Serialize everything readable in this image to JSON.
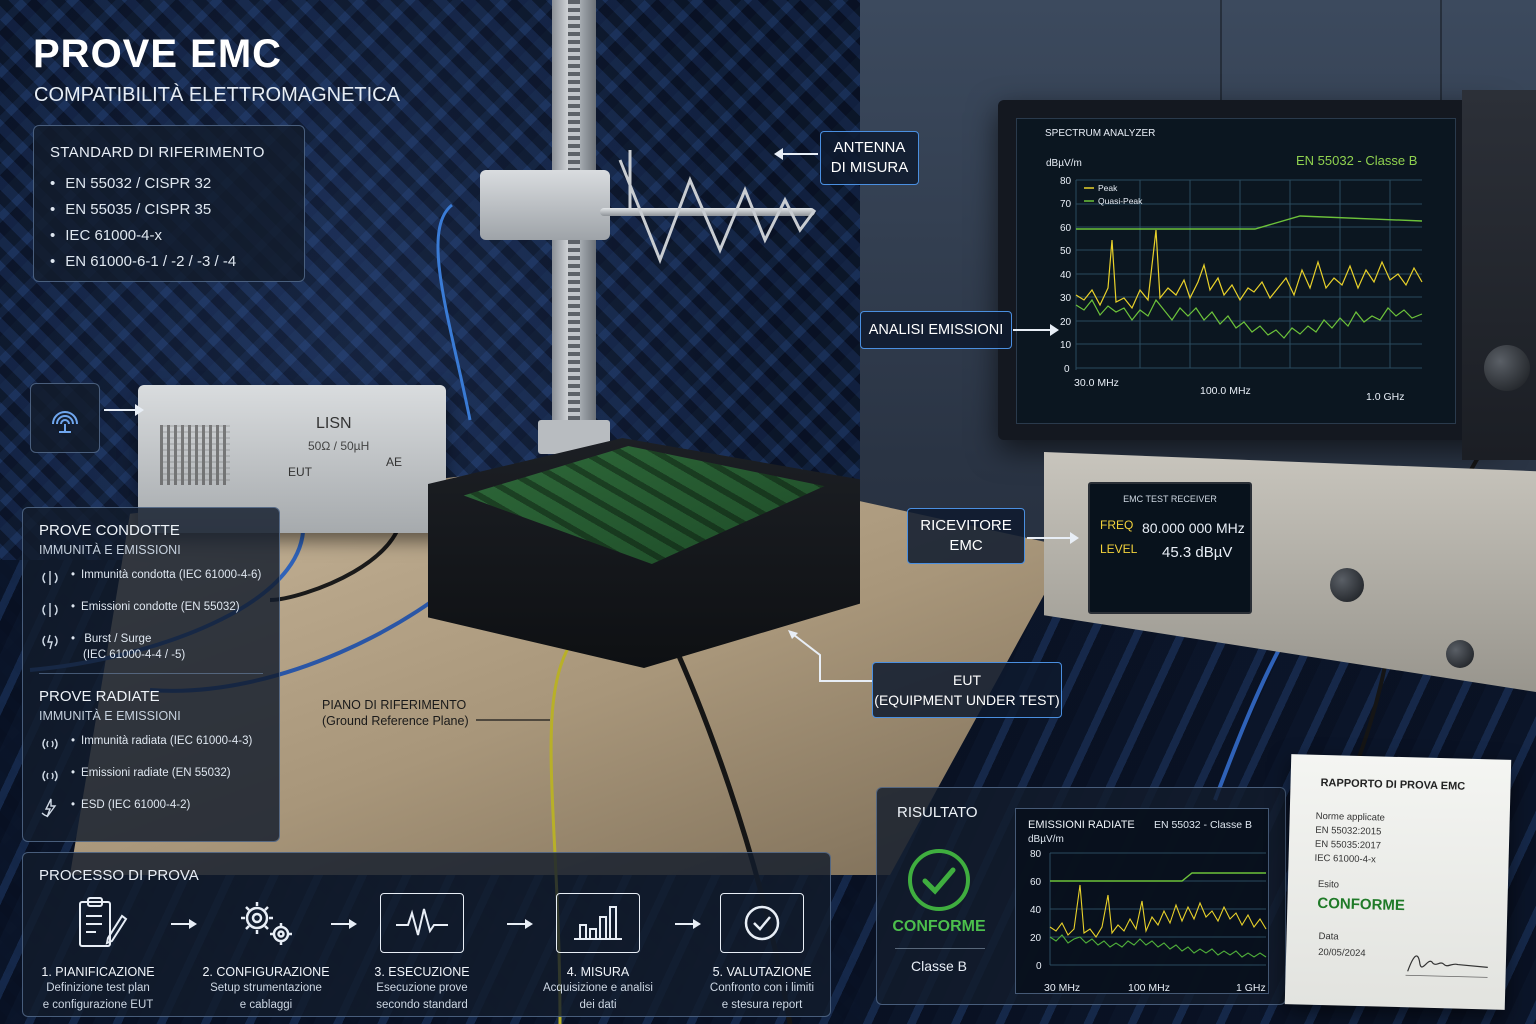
{
  "header": {
    "title": "PROVE EMC",
    "subtitle": "COMPATIBILITÀ ELETTROMAGNETICA"
  },
  "standards": {
    "title": "STANDARD DI RIFERIMENTO",
    "items": [
      "EN 55032 / CISPR 32",
      "EN 55035 / CISPR 35",
      "IEC 61000-4-x",
      "EN 61000-6-1 / -2 / -3 / -4"
    ]
  },
  "lisn": {
    "name": "LISN",
    "spec": "50Ω / 50µH",
    "port_eut": "EUT",
    "port_ae": "AE"
  },
  "conducted": {
    "title": "PROVE CONDOTTE",
    "subtitle": "IMMUNITÀ E EMISSIONI",
    "items": [
      {
        "label": "Immunità condotta (IEC 61000-4-6)",
        "icon": "conducted-signal-icon"
      },
      {
        "label": "Emissioni condotte (EN 55032)",
        "icon": "conducted-signal-icon"
      },
      {
        "label": "Burst / Surge",
        "label2": "(IEC 61000-4-4 / -5)",
        "icon": "burst-surge-icon"
      }
    ]
  },
  "radiated": {
    "title": "PROVE RADIATE",
    "subtitle": "IMMUNITÀ E EMISSIONI",
    "items": [
      {
        "label": "Immunità radiata (IEC 61000-4-3)",
        "icon": "radiated-signal-icon"
      },
      {
        "label": "Emissioni radiate (EN 55032)",
        "icon": "radiated-signal-icon"
      },
      {
        "label": "ESD (IEC 61000-4-2)",
        "icon": "esd-icon"
      }
    ]
  },
  "process": {
    "title": "PROCESSO DI PROVA",
    "steps": [
      {
        "label": "1. PIANIFICAZIONE",
        "desc1": "Definizione test plan",
        "desc2": "e configurazione EUT",
        "icon": "clipboard-icon"
      },
      {
        "label": "2. CONFIGURAZIONE",
        "desc1": "Setup strumentazione",
        "desc2": "e cablaggi",
        "icon": "gears-icon"
      },
      {
        "label": "3. ESECUZIONE",
        "desc1": "Esecuzione prove",
        "desc2": "secondo standard",
        "icon": "waveform-icon"
      },
      {
        "label": "4. MISURA",
        "desc1": "Acquisizione e analisi",
        "desc2": "dei dati",
        "icon": "bar-chart-icon"
      },
      {
        "label": "5. VALUTAZIONE",
        "desc1": "Confronto con i limiti",
        "desc2": "e stesura report",
        "icon": "check-circle-icon"
      }
    ]
  },
  "callouts": {
    "antenna_1": "ANTENNA",
    "antenna_2": "DI MISURA",
    "analisi": "ANALISI EMISSIONI",
    "ricevitore_1": "RICEVITORE",
    "ricevitore_2": "EMC",
    "eut_1": "EUT",
    "eut_2": "(EQUIPMENT UNDER TEST)",
    "plane_1": "PIANO DI RIFERIMENTO",
    "plane_2": "(Ground Reference Plane)"
  },
  "spectrum_analyzer": {
    "title": "SPECTRUM ANALYZER",
    "standard": "EN 55032 - Classe B",
    "unit": "dBµV/m",
    "legend_peak": "Peak",
    "legend_qp": "Quasi-Peak",
    "y_ticks": [
      "80",
      "70",
      "60",
      "50",
      "40",
      "30",
      "20",
      "10",
      "0"
    ],
    "x_ticks": [
      "30.0 MHz",
      "100.0 MHz",
      "1.0 GHz"
    ]
  },
  "receiver": {
    "title": "EMC TEST RECEIVER",
    "freq_label": "FREQ",
    "freq_value": "80.000 000 MHz",
    "level_label": "LEVEL",
    "level_value": "45.3 dBµV"
  },
  "result": {
    "title": "RISULTATO",
    "status": "CONFORME",
    "class": "Classe B",
    "chart_title": "EMISSIONI RADIATE",
    "chart_std": "EN 55032 - Classe B",
    "chart_unit": "dBµV/m",
    "y_ticks": [
      "80",
      "60",
      "40",
      "20",
      "0"
    ],
    "x_ticks": [
      "30 MHz",
      "100 MHz",
      "1 GHz"
    ]
  },
  "report": {
    "title": "RAPPORTO DI PROVA EMC",
    "norms_label": "Norme applicate",
    "norms": [
      "EN 55032:2015",
      "EN 55035:2017",
      "IEC 61000-4-x"
    ],
    "esito_label": "Esito",
    "esito": "CONFORME",
    "date_label": "Data",
    "date": "20/05/2024"
  },
  "colors": {
    "accent_blue": "#4a8fe0",
    "ok_green": "#4cbf4c",
    "peak_yellow": "#e8d12a",
    "qp_green": "#6cc23a"
  }
}
